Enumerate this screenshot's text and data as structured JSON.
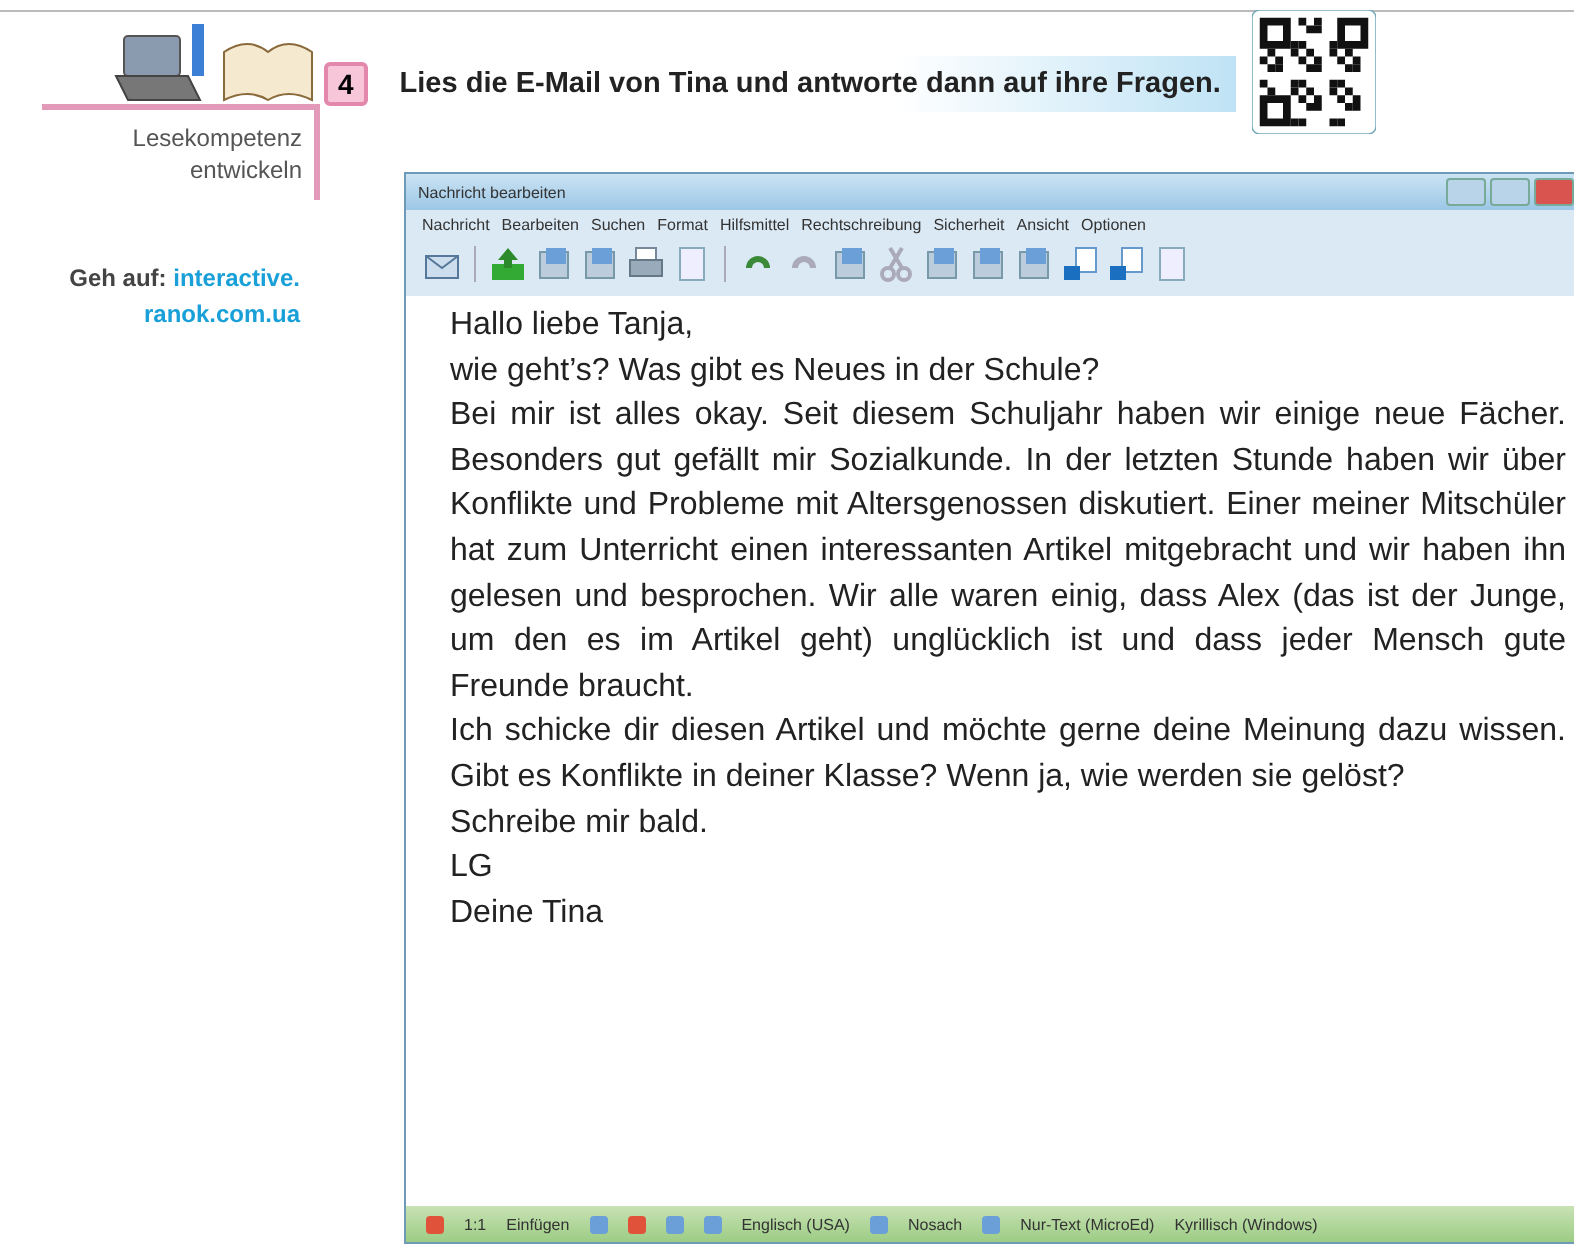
{
  "sidebar": {
    "label_lines": [
      "Lesekompetenz",
      "entwickeln"
    ],
    "link_prefix": "Geh auf:",
    "link_lines": [
      "interactive.",
      "ranok.com.ua"
    ]
  },
  "task": {
    "number": "4",
    "title": "Lies die E-Mail von Tina und antworte dann auf ihre Fragen."
  },
  "window": {
    "title": "Nachricht bearbeiten",
    "menu": [
      "Nachricht",
      "Bearbeiten",
      "Suchen",
      "Format",
      "Hilfsmittel",
      "Rechtschreibung",
      "Sicherheit",
      "Ansicht",
      "Optionen"
    ],
    "body": [
      "Hallo liebe Tanja,",
      "wie geht’s? Was gibt es Neues in der Schule?",
      "Bei mir ist alles okay. Seit diesem Schuljahr haben wir einige neue Fächer. Besonders gut gefällt mir Sozialkunde. In der letzten Stunde haben wir über Konflikte und Probleme mit Altersgenossen diskutiert. Einer meiner Mitschüler hat zum Unterricht einen interessanten Artikel mitgebracht und wir haben ihn gelesen und besprochen. Wir alle waren einig, dass Alex (das ist der Junge, um den es im Artikel geht) unglücklich ist und dass jeder Mensch gute Freunde braucht.",
      "Ich schicke dir diesen Artikel und möchte gerne deine Meinung dazu wissen. Gibt es Konflikte in deiner Klasse? Wenn ja, wie werden sie gelöst?",
      "Schreibe mir bald.",
      "LG",
      "Deine Tina"
    ],
    "status": [
      "1:1",
      "Einfügen",
      "Englisch (USA)",
      "Nosach",
      "Nur-Text (MicroEd)",
      "Kyrillisch (Windows)"
    ]
  }
}
